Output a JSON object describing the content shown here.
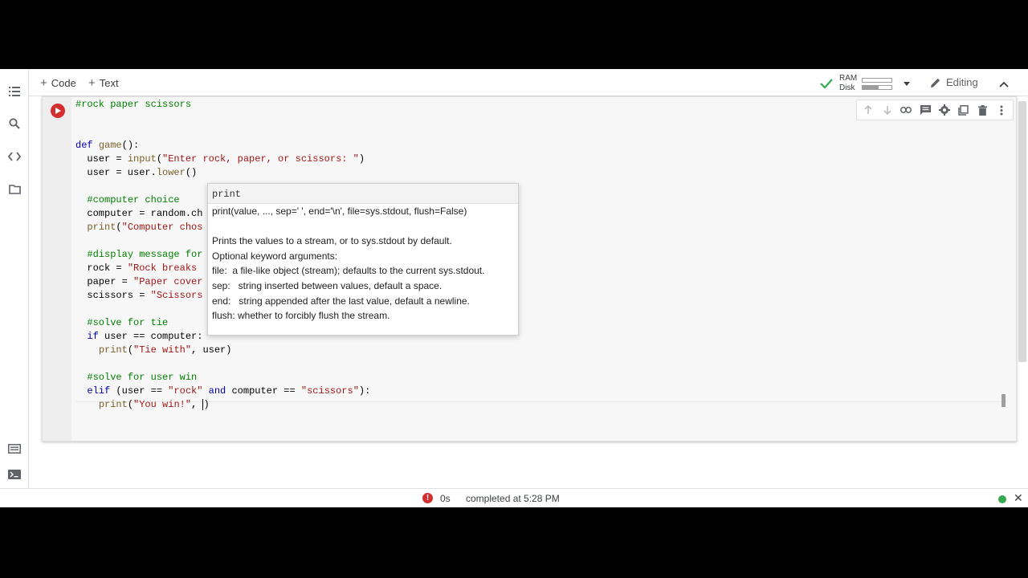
{
  "toolbar": {
    "add_code_label": "Code",
    "add_text_label": "Text",
    "ram_label": "RAM",
    "disk_label": "Disk",
    "ram_usage": 0.0,
    "disk_usage": 0.55,
    "editing_label": "Editing"
  },
  "cell": {
    "lines": [
      "#rock paper scissors",
      "",
      "",
      "def game():",
      "  user = input(\"Enter rock, paper, or scissors: \")",
      "  user = user.lower()",
      "",
      "  #computer choice",
      "  computer = random.ch",
      "  print(\"Computer chos",
      "",
      "  #display message for",
      "  rock = \"Rock breaks",
      "  paper = \"Paper cover",
      "  scissors = \"Scissors",
      "",
      "  #solve for tie",
      "  if user == computer:",
      "    print(\"Tie with\", user)",
      "",
      "  #solve for user win",
      "  elif (user == \"rock\" and computer == \"scissors\"):",
      "    print(\"You win!\", )"
    ]
  },
  "tooltip": {
    "title": "print",
    "lines": [
      "print(value, ..., sep=' ', end='\\n', file=sys.stdout, flush=False)",
      "",
      "Prints the values to a stream, or to sys.stdout by default.",
      "Optional keyword arguments:",
      "file:  a file-like object (stream); defaults to the current sys.stdout.",
      "sep:   string inserted between values, default a space.",
      "end:   string appended after the last value, default a newline.",
      "flush: whether to forcibly flush the stream."
    ]
  },
  "status": {
    "error_glyph": "!",
    "duration": "0s",
    "message": "completed at 5:28 PM",
    "close_glyph": "✕"
  },
  "colors": {
    "run_button": "#d32f2f",
    "connected": "#34a853",
    "comment": "#008000",
    "keyword": "#0000b0",
    "string": "#a31515"
  }
}
